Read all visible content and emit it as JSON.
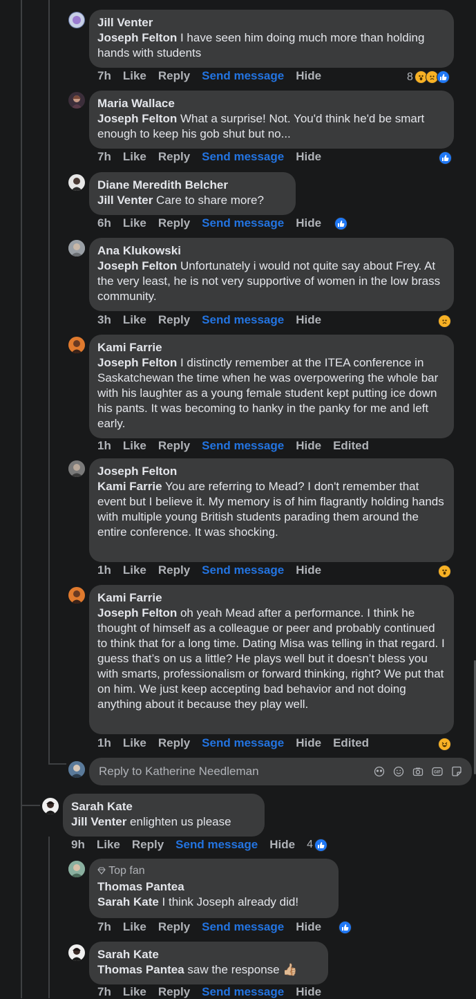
{
  "comments": [
    {
      "author": "Jill Venter",
      "tag": "Joseph Felton",
      "text": " I have seen him doing much more than holding hands with students",
      "time": "7h",
      "react_count": "8"
    },
    {
      "author": "Maria Wallace",
      "tag": "Joseph Felton",
      "text": " What a surprise! Not. You'd think he'd be smart enough to keep his gob shut but no...",
      "time": "7h"
    },
    {
      "author": "Diane Meredith Belcher",
      "tag": "Jill Venter",
      "text": " Care to share more?",
      "time": "6h"
    },
    {
      "author": "Ana Klukowski",
      "tag": "Joseph Felton",
      "text": " Unfortunately i would not quite say about Frey. At the very least, he is not very supportive of women in the low brass community.",
      "time": "3h"
    },
    {
      "author": "Kami Farrie",
      "tag": "Joseph Felton",
      "text": " I distinctly remember at the ITEA conference in Saskatchewan the time when he was overpowering the whole bar with his laughter as a young female student kept putting ice down his pants. It was becoming to hanky in the panky for me and left early.",
      "time": "1h",
      "edited": "Edited"
    },
    {
      "author": "Joseph Felton",
      "tag": "Kami Farrie",
      "text": " You are referring to Mead? I don't remember that event but I believe it. My memory is of him flagrantly holding hands with multiple young British students parading them around the entire conference. It was shocking.",
      "time": "1h"
    },
    {
      "author": "Kami Farrie",
      "tag": "Joseph Felton",
      "text": " oh yeah Mead after a performance. I think he thought of himself as a colleague or peer and probably continued to think that for a long time. Dating Misa was telling in that regard. I guess that’s on us a little? He plays well but it doesn’t bless you with smarts, professionalism or forward thinking, right? We put that on him. We just keep accepting bad behavior and not doing anything about it because they play well.",
      "time": "1h",
      "edited": "Edited"
    },
    {
      "author": "Sarah Kate",
      "tag": "Jill Venter",
      "text": " enlighten us please",
      "time": "9h",
      "react_count": "4"
    },
    {
      "badge": "Top fan",
      "author": "Thomas Pantea",
      "tag": "Sarah Kate",
      "text": " I think Joseph already did!",
      "time": "7h"
    },
    {
      "author": "Sarah Kate",
      "tag": "Thomas Pantea",
      "text": " saw the response 👍🏼",
      "time": "7h"
    }
  ],
  "actions": {
    "like": "Like",
    "reply": "Reply",
    "send": "Send message",
    "hide": "Hide"
  },
  "reply_box": {
    "placeholder": "Reply to Katherine Needleman"
  },
  "icons": {
    "like": "like-reaction-icon",
    "wow": "wow-reaction-icon",
    "sad": "sad-reaction-icon",
    "haha": "haha-reaction-icon",
    "avatar": "avatar",
    "emoji": "emoji-icon",
    "camera": "camera-icon",
    "gif": "gif-icon",
    "sticker": "sticker-icon",
    "avatar_sticker": "avatar-sticker-icon",
    "diamond": "top-fan-diamond-icon"
  },
  "colors": {
    "background": "#18191a",
    "bubble": "#3a3b3c",
    "text": "#e4e6eb",
    "secondary": "#b0b3b8",
    "link": "#2374e1",
    "like_blue": "#2078f4",
    "emoji_yellow": "#f7b125"
  }
}
